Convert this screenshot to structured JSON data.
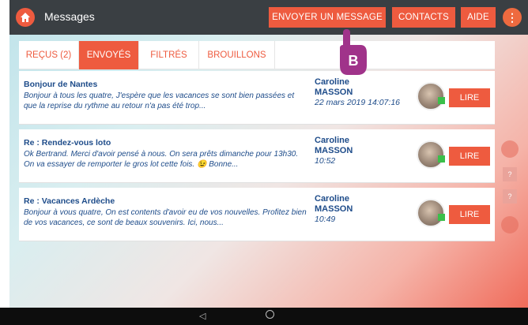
{
  "header": {
    "title": "Messages",
    "buttons": {
      "send": "ENVOYER UN MESSAGE",
      "contacts": "CONTACTS",
      "help": "AIDE",
      "more": "⋮"
    }
  },
  "tabs": [
    {
      "label": "REÇUS (2)",
      "active": false
    },
    {
      "label": "ENVOYÉS",
      "active": true
    },
    {
      "label": "FILTRÉS",
      "active": false
    },
    {
      "label": "BROUILLONS",
      "active": false
    }
  ],
  "messages": [
    {
      "subject": "Bonjour de Nantes",
      "preview": "Bonjour à tous les quatre,  J'espère que les vacances se sont bien passées et que la reprise du  rythme au retour n'a pas été trop...",
      "sender_first": "Caroline",
      "sender_last": "MASSON",
      "date": "22 mars 2019 14:07:16",
      "read_label": "LIRE"
    },
    {
      "subject": "Re : Rendez-vous loto",
      "preview": "Ok Bertrand. Merci d'avoir pensé à nous. On sera prêts dimanche pour 13h30. On va essayer de remporter le gros lot cette fois. 😉 Bonne...",
      "sender_first": "Caroline",
      "sender_last": "MASSON",
      "date": "10:52",
      "read_label": "LIRE"
    },
    {
      "subject": "Re : Vacances Ardèche",
      "preview": "Bonjour à vous quatre, On est contents d'avoir eu de vos nouvelles. Profitez bien de vos vacances, ce sont de beaux souvenirs. Ici, nous...",
      "sender_first": "Caroline",
      "sender_last": "MASSON",
      "date": "10:49",
      "read_label": "LIRE"
    }
  ],
  "annotation": {
    "label": "B"
  },
  "side": {
    "q1": "?",
    "q2": "?"
  },
  "nav": {
    "back": "◁"
  },
  "colors": {
    "accent": "#ee5b3f",
    "topbar": "#3a3f43",
    "text_blue": "#1e4c8a"
  },
  "icons": [
    "home-icon",
    "more-icon",
    "pointer-hand-icon",
    "back-nav-icon",
    "home-nav-icon"
  ]
}
